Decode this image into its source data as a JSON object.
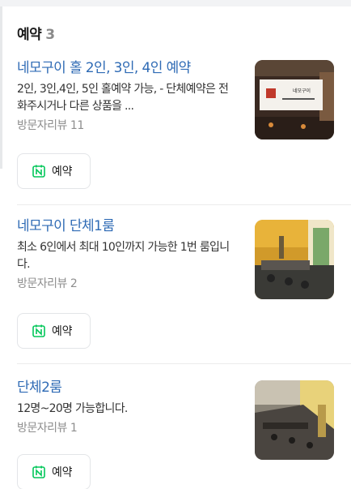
{
  "section": {
    "title": "예약",
    "count": "3"
  },
  "items": [
    {
      "name": "네모구이 홀 2인, 3인, 4인 예약",
      "description": "2인, 3인,4인, 5인 홀예약 가능, - 단체예약은 전화주시거나 다른 상품을 ...",
      "review_label": "방문자리뷰",
      "review_count": "11",
      "button_label": "예약",
      "thumb_text": "네모구이"
    },
    {
      "name": "네모구이 단체1룸",
      "description": "최소 6인에서 최대 10인까지 가능한 1번 룸입니다.",
      "review_label": "방문자리뷰",
      "review_count": "2",
      "button_label": "예약"
    },
    {
      "name": "단체2룸",
      "description": "12명~20명 가능합니다.",
      "review_label": "방문자리뷰",
      "review_count": "1",
      "button_label": "예약"
    }
  ],
  "icons": {
    "button_icon": "naver-booking-calendar-icon"
  },
  "colors": {
    "link": "#2f6bb5",
    "naver_green": "#03c75a"
  }
}
